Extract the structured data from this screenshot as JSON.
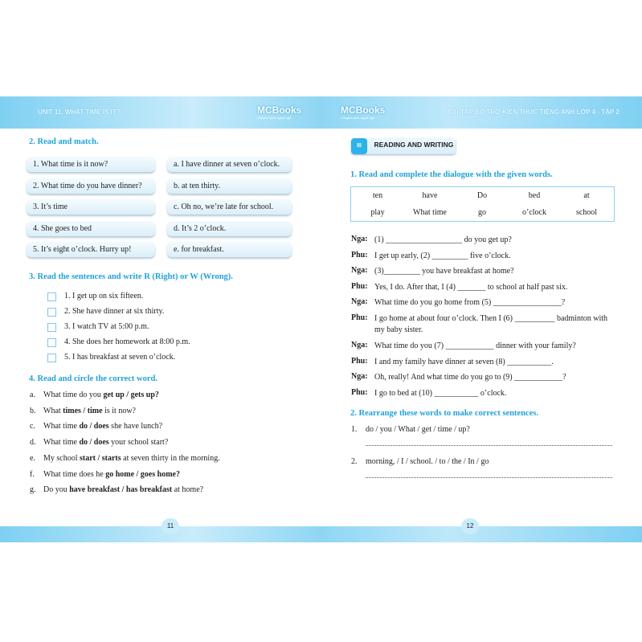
{
  "left": {
    "header": "UNIT 11. WHAT TIME IS IT?",
    "logo": "MCBooks",
    "logo_tag": "Chuyên sách ngoại ngữ",
    "page": "11",
    "s2": {
      "title": "2. Read and match.",
      "left": [
        "1. What time is it now?",
        "2. What time do you have dinner?",
        "3. It’s time",
        "4. She goes to bed",
        "5. It’s eight o’clock. Hurry up!"
      ],
      "right": [
        "a. I have dinner at seven o’clock.",
        "b. at ten thirty.",
        "c. Oh no, we’re late for school.",
        "d. It’s 2 o’clock.",
        "e. for breakfast."
      ]
    },
    "s3": {
      "title": "3. Read the sentences and write R (Right) or W (Wrong).",
      "items": [
        "1. I get up on six fifteen.",
        "2. She have dinner at six thirty.",
        "3. I watch TV at 5:00 p.m.",
        "4. She does her homework at 8:00 p.m.",
        "5. I has breakfast at seven o’clock."
      ]
    },
    "s4": {
      "title": "4. Read and circle the correct word.",
      "items": [
        {
          "l": "a.",
          "pre": "What time do you ",
          "b": "get up / gets up?",
          "post": ""
        },
        {
          "l": "b.",
          "pre": "What ",
          "b": "times / time",
          "post": " is it now?"
        },
        {
          "l": "c.",
          "pre": "What time ",
          "b": "do / does",
          "post": " she have lunch?"
        },
        {
          "l": "d.",
          "pre": "What time ",
          "b": "do / does",
          "post": " your school start?"
        },
        {
          "l": "e.",
          "pre": "My school ",
          "b": "start / starts",
          "post": " at seven thirty in the morning."
        },
        {
          "l": "f.",
          "pre": "What time does he ",
          "b": "go home / goes home?",
          "post": ""
        },
        {
          "l": "g.",
          "pre": "Do you ",
          "b": "have breakfast / has breakfast",
          "post": " at home?"
        }
      ]
    }
  },
  "right": {
    "header": "BÀI TẬP BỔ TRỢ KIẾN THỨC TIẾNG ANH LỚP 4 - TẬP 2",
    "logo": "MCBooks",
    "logo_tag": "Chuyên sách ngoại ngữ",
    "page": "12",
    "section_num": "III",
    "section_title": "READING AND WRITING",
    "s1": {
      "title": "1. Read and complete the dialogue with the given words.",
      "words": [
        "ten",
        "have",
        "Do",
        "bed",
        "at",
        "play",
        "What time",
        "go",
        "o’clock",
        "school"
      ],
      "lines": [
        {
          "s": "Nga:",
          "t": "(1) ___________________ do you get up?"
        },
        {
          "s": "Phu:",
          "t": "I get up early, (2) _________ five o’clock."
        },
        {
          "s": "Nga:",
          "t": "(3)_________ you have breakfast at home?"
        },
        {
          "s": "Phu:",
          "t": "Yes, I do. After that, I (4) _______ to school at half past six."
        },
        {
          "s": "Nga:",
          "t": "What time do you go home from (5) _________________?"
        },
        {
          "s": "Phu:",
          "t": "I go home at about four o’clock. Then I (6) __________ badminton with my baby sister."
        },
        {
          "s": "Nga:",
          "t": "What time do you (7) ____________ dinner with your family?"
        },
        {
          "s": "Phu:",
          "t": "I and my family have dinner at seven (8) ___________."
        },
        {
          "s": "Nga:",
          "t": "Oh, really! And what time do you go to (9) ____________?"
        },
        {
          "s": "Phu:",
          "t": "I go to bed at (10) ___________ o’clock."
        }
      ]
    },
    "s2": {
      "title": "2. Rearrange these words to make correct sentences.",
      "items": [
        {
          "n": "1.",
          "t": "do / you / What / get / time / up?"
        },
        {
          "n": "2.",
          "t": "morning, / I / school. / to / the / In / go"
        }
      ]
    }
  }
}
